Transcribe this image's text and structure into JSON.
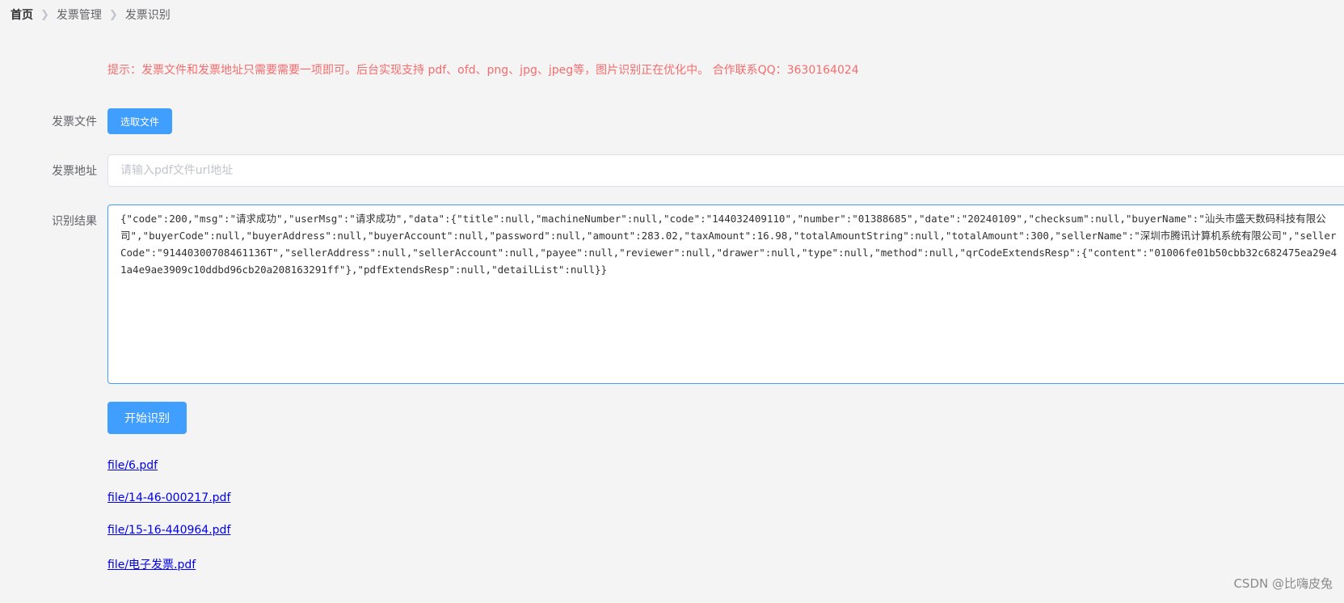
{
  "breadcrumb": [
    "首页",
    "发票管理",
    "发票识别"
  ],
  "tip": "提示：发票文件和发票地址只需要需要一项即可。后台实现支持 pdf、ofd、png、jpg、jpeg等，图片识别正在优化中。 合作联系QQ：3630164024",
  "form": {
    "file_label": "发票文件",
    "choose_button": "选取文件",
    "url_label": "发票地址",
    "url_placeholder": "请输入pdf文件url地址",
    "result_label": "识别结果",
    "result_text": "{\"code\":200,\"msg\":\"请求成功\",\"userMsg\":\"请求成功\",\"data\":{\"title\":null,\"machineNumber\":null,\"code\":\"144032409110\",\"number\":\"01388685\",\"date\":\"20240109\",\"checksum\":null,\"buyerName\":\"汕头市盛天数码科技有限公司\",\"buyerCode\":null,\"buyerAddress\":null,\"buyerAccount\":null,\"password\":null,\"amount\":283.02,\"taxAmount\":16.98,\"totalAmountString\":null,\"totalAmount\":300,\"sellerName\":\"深圳市腾讯计算机系统有限公司\",\"sellerCode\":\"91440300708461136T\",\"sellerAddress\":null,\"sellerAccount\":null,\"payee\":null,\"reviewer\":null,\"drawer\":null,\"type\":null,\"method\":null,\"qrCodeExtendsResp\":{\"content\":\"01006fe01b50cbb32c682475ea29e41a4e9ae3909c10ddbd96cb20a208163291ff\"},\"pdfExtendsResp\":null,\"detailList\":null}}",
    "start_button": "开始识别"
  },
  "files": [
    "file/6.pdf",
    "file/14-46-000217.pdf",
    "file/15-16-440964.pdf",
    "file/电子发票.pdf"
  ],
  "watermark": "CSDN @比嗨皮兔",
  "colors": {
    "primary": "#409eff",
    "tip": "#f56c6c",
    "link": "#0000ee"
  }
}
